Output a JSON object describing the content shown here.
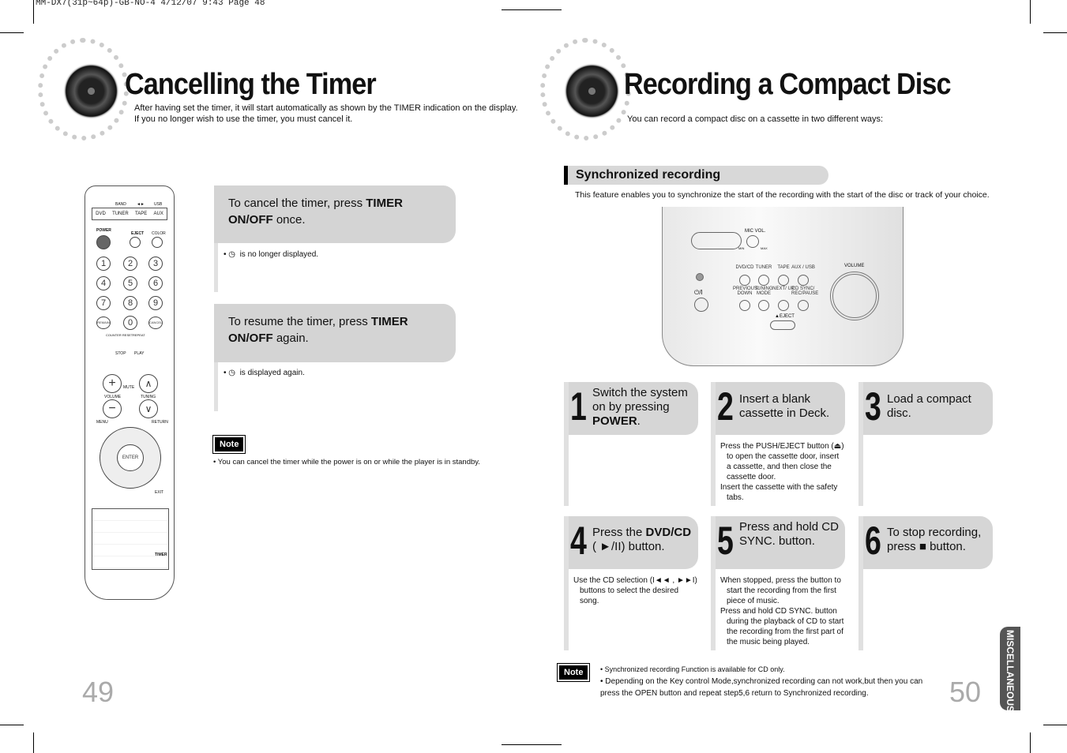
{
  "print_header": "MM-DX7(31p~64p)-GB-NO-4   4/12/07   9:43   Page 48",
  "left": {
    "title": "Cancelling the Timer",
    "intro": [
      "After having set the timer, it will start automatically as shown by the TIMER indication on the display.",
      "If you no longer wish to use the timer, you must cancel it."
    ],
    "cancel": {
      "text": "To cancel the timer, press ",
      "bold": "TIMER ON/OFF",
      "after": " once.",
      "bullet": "is no longer displayed."
    },
    "resume": {
      "text": "To resume the timer, press ",
      "bold": "TIMER ON/OFF",
      "after": " again.",
      "bullet": "is displayed again."
    },
    "note_label": "Note",
    "note": "You can cancel the timer while the power is on or while the player is in standby.",
    "page_number": "49",
    "remote": {
      "top_labels": [
        "BAND",
        "◄►",
        "USB"
      ],
      "source_buttons": [
        "DVD",
        "TUNER",
        "TAPE",
        "AUX"
      ],
      "power": "POWER",
      "eject": "EJECT",
      "color": "COLOR",
      "digits": [
        "1",
        "2",
        "3",
        "4",
        "5",
        "6",
        "7",
        "8",
        "9",
        "REMAIN",
        "0",
        "CANCEL"
      ],
      "labels": [
        "COUNTER RESET",
        "REPEAT",
        "STOP",
        "PLAY",
        "VOLUME",
        "MUTE",
        "TUNING",
        "MENU",
        "RETURN",
        "ENTER",
        "EXIT",
        "TIMER"
      ]
    }
  },
  "right": {
    "title": "Recording a Compact Disc",
    "intro": "You can record a compact disc on a cassette in two different ways:",
    "section": "Synchronized recording",
    "section_desc": "This feature enables you to synchronize the start of the recording with the start of the disc or track of your choice.",
    "device": {
      "labels": [
        "MIC VOL.",
        "MIN",
        "MAX",
        "DVD/CD",
        "TUNER",
        "TAPE",
        "AUX / USB",
        "PREVIOUS/ DOWN",
        "TUNING MODE",
        "NEXT/ UP",
        "CD SYNC/ REC/PAUSE",
        "VOLUME",
        "▲EJECT",
        "⏻/I"
      ]
    },
    "steps": [
      {
        "n": "1",
        "text": "Switch the system on by pressing ",
        "bold": "POWER",
        "after": ".",
        "bullets": []
      },
      {
        "n": "2",
        "text": "Insert a blank cassette in Deck.",
        "bullets": [
          "Press the PUSH/EJECT button (⏏) to open the cassette door, insert a cassette, and then close the cassette door.",
          "Insert the cassette with the safety tabs."
        ]
      },
      {
        "n": "3",
        "text": "Load a compact disc.",
        "bullets": []
      },
      {
        "n": "4",
        "text": "Press the ",
        "bold": "DVD/CD",
        "after": " ( ►/II) button.",
        "bullets": [
          "Use the CD selection (I◄◄ , ►►I) buttons to select the desired song."
        ]
      },
      {
        "n": "5",
        "text": "Press and hold CD SYNC. button.",
        "bullets": [
          "When stopped, press the button to start the recording from the first piece of music.",
          "Press and hold CD SYNC. button during the playback of CD to start the recording from the first part of the music being played."
        ]
      },
      {
        "n": "6",
        "text": "To stop recording, press ■ button.",
        "bullets": []
      }
    ],
    "note_label": "Note",
    "notes": [
      "Synchronized recording Function is available for  CD only.",
      "Depending on the Key control Mode,synchronized recording can not work,but then you can press the OPEN button and repeat step5,6 return to Synchronized recording."
    ],
    "page_number": "50",
    "tab": "MISCELLANEOUS"
  }
}
